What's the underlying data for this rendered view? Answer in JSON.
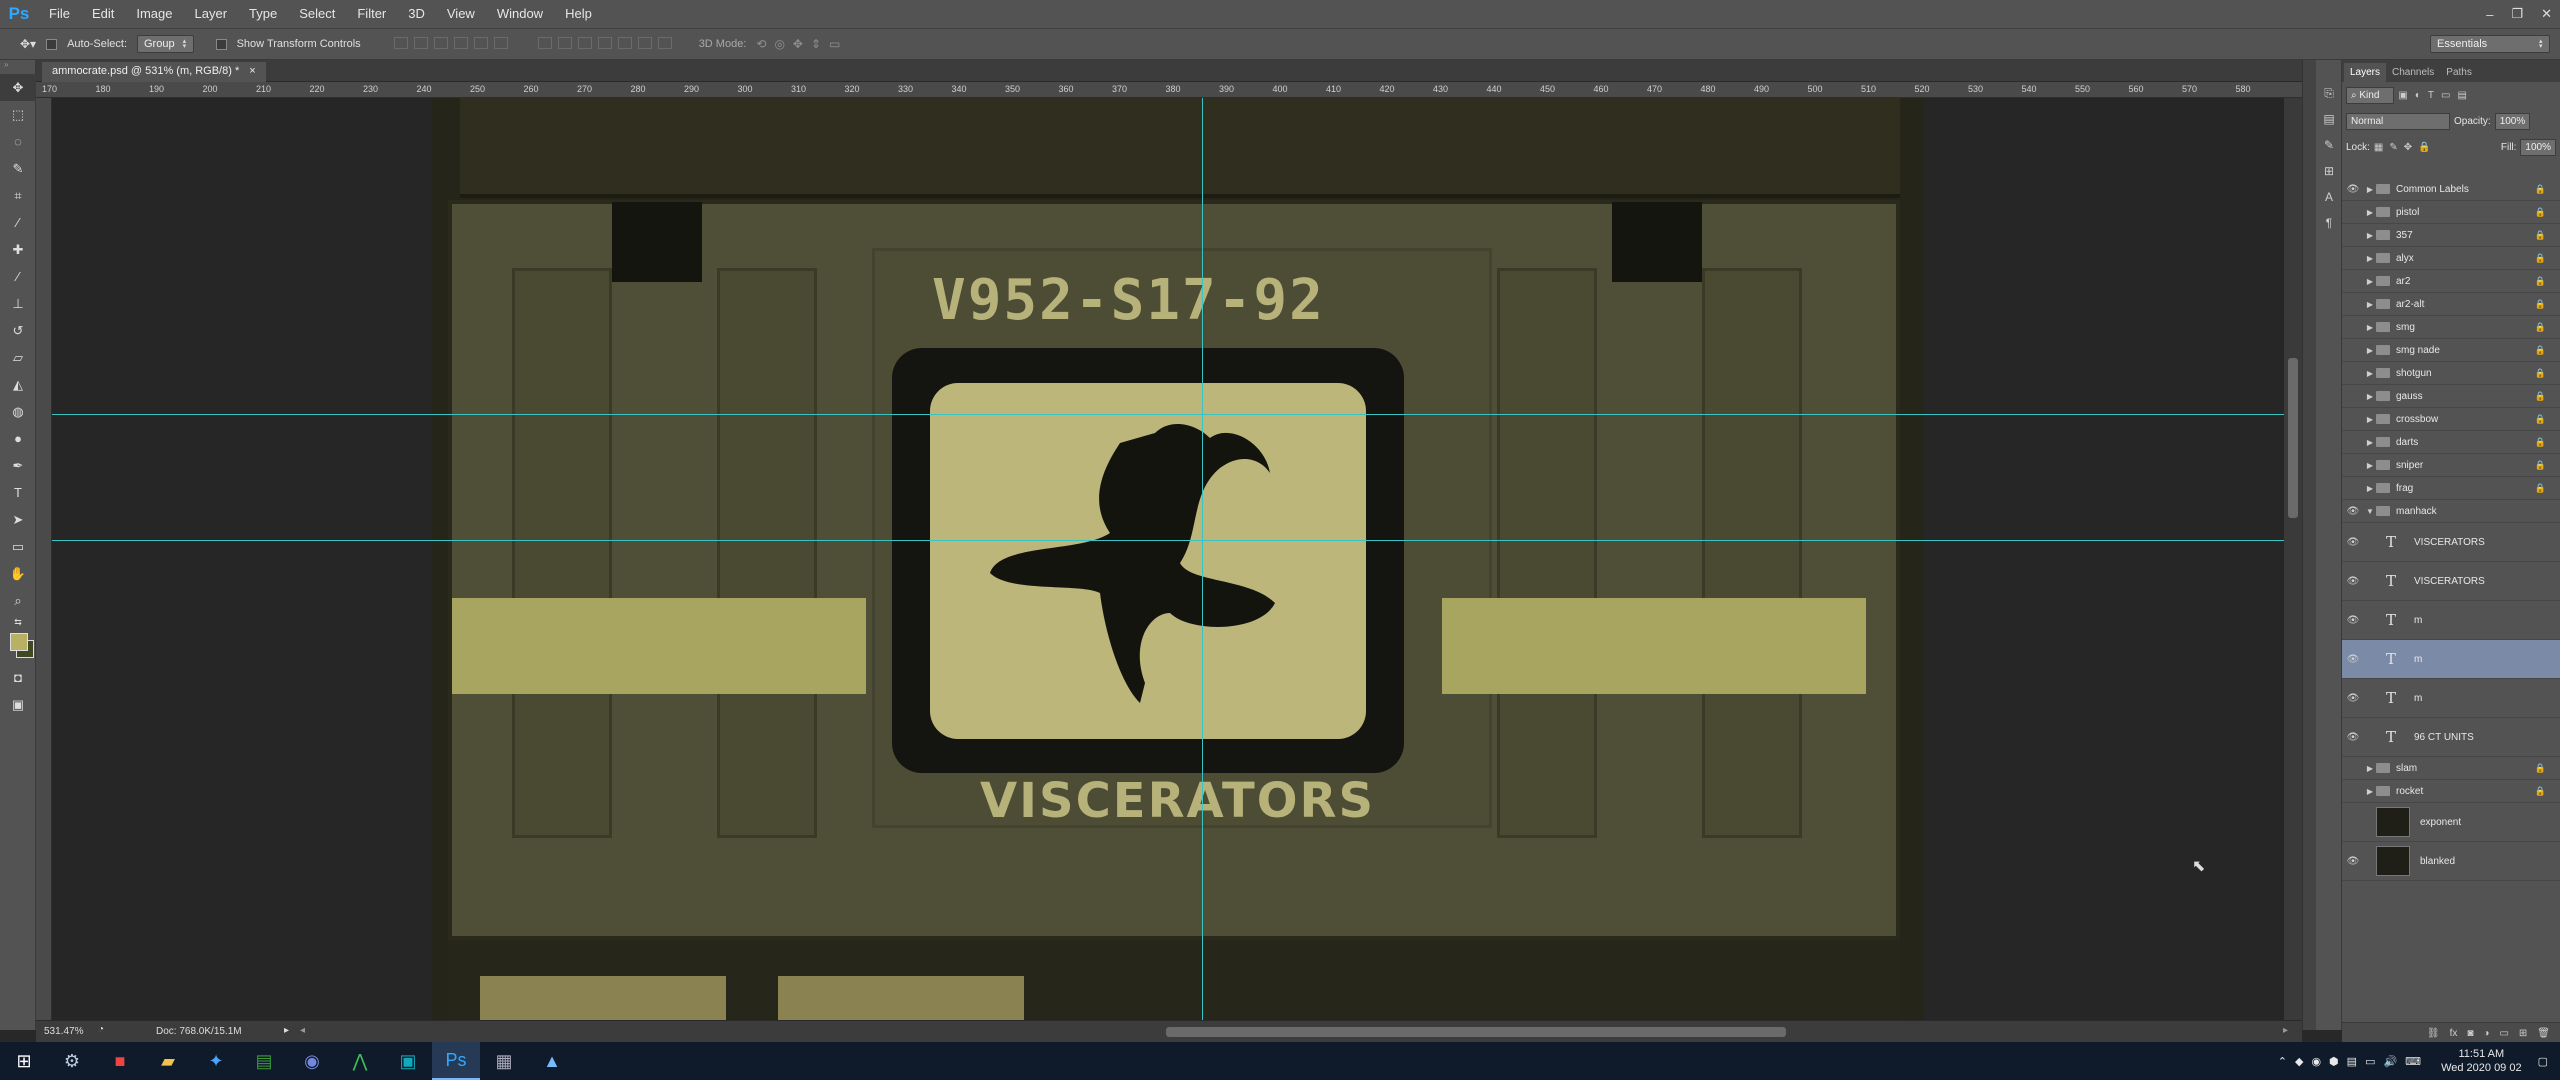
{
  "app": {
    "logo": "Ps",
    "menu": [
      "File",
      "Edit",
      "Image",
      "Layer",
      "Type",
      "Select",
      "Filter",
      "3D",
      "View",
      "Window",
      "Help"
    ],
    "window_controls": [
      "–",
      "❐",
      "✕"
    ]
  },
  "options_bar": {
    "auto_select_label": "Auto-Select:",
    "auto_select_value": "Group",
    "show_transform_label": "Show Transform Controls",
    "mode_3d_label": "3D Mode:",
    "workspace": "Essentials"
  },
  "document": {
    "tab_title": "ammocrate.psd @ 531% (m, RGB/8) *",
    "tab_close": "×",
    "ruler_ticks": [
      "170",
      "180",
      "190",
      "200",
      "210",
      "220",
      "230",
      "240",
      "250",
      "260",
      "270",
      "280",
      "290",
      "300",
      "310",
      "320",
      "330",
      "340",
      "350",
      "360",
      "370",
      "380",
      "390",
      "400",
      "410",
      "420",
      "430",
      "440",
      "450",
      "460",
      "470",
      "480",
      "490",
      "500",
      "510",
      "520",
      "530",
      "540",
      "550",
      "560",
      "570",
      "580"
    ],
    "artwork_code_text": "V952-S17-92",
    "artwork_name_text": "VISCERATORS"
  },
  "status": {
    "zoom": "531.47%",
    "doc_size": "Doc: 768.0K/15.1M"
  },
  "panel": {
    "tabs": [
      "Layers",
      "Channels",
      "Paths"
    ],
    "kind_label": "Kind",
    "blend_mode": "Normal",
    "opacity_label": "Opacity:",
    "opacity_value": "100%",
    "lock_label": "Lock:",
    "fill_label": "Fill:",
    "fill_value": "100%"
  },
  "layers": [
    {
      "name": "Common Labels",
      "type": "group",
      "visible": true,
      "locked": true
    },
    {
      "name": "pistol",
      "type": "group",
      "visible": false,
      "locked": true
    },
    {
      "name": "357",
      "type": "group",
      "visible": false,
      "locked": true
    },
    {
      "name": "alyx",
      "type": "group",
      "visible": false,
      "locked": true
    },
    {
      "name": "ar2",
      "type": "group",
      "visible": false,
      "locked": true
    },
    {
      "name": "ar2-alt",
      "type": "group",
      "visible": false,
      "locked": true
    },
    {
      "name": "smg",
      "type": "group",
      "visible": false,
      "locked": true
    },
    {
      "name": "smg nade",
      "type": "group",
      "visible": false,
      "locked": true
    },
    {
      "name": "shotgun",
      "type": "group",
      "visible": false,
      "locked": true
    },
    {
      "name": "gauss",
      "type": "group",
      "visible": false,
      "locked": true
    },
    {
      "name": "crossbow",
      "type": "group",
      "visible": false,
      "locked": true
    },
    {
      "name": "darts",
      "type": "group",
      "visible": false,
      "locked": true
    },
    {
      "name": "sniper",
      "type": "group",
      "visible": false,
      "locked": true
    },
    {
      "name": "frag",
      "type": "group",
      "visible": false,
      "locked": true
    },
    {
      "name": "manhack",
      "type": "group-open",
      "visible": true,
      "locked": false
    },
    {
      "name": "VISCERATORS",
      "type": "text",
      "visible": true,
      "locked": false
    },
    {
      "name": "VISCERATORS",
      "type": "text",
      "visible": true,
      "locked": false
    },
    {
      "name": "m",
      "type": "text",
      "visible": true,
      "locked": false
    },
    {
      "name": "m",
      "type": "text-selected",
      "visible": true,
      "locked": false
    },
    {
      "name": "m",
      "type": "text",
      "visible": true,
      "locked": false
    },
    {
      "name": "96 CT UNITS",
      "type": "text",
      "visible": true,
      "locked": false
    },
    {
      "name": "slam",
      "type": "group",
      "visible": false,
      "locked": true
    },
    {
      "name": "rocket",
      "type": "group",
      "visible": false,
      "locked": true
    },
    {
      "name": "exponent",
      "type": "image",
      "visible": false,
      "locked": false
    },
    {
      "name": "blanked",
      "type": "image",
      "visible": true,
      "locked": false
    }
  ],
  "taskbar": {
    "clock_time": "11:51 AM",
    "clock_date": "Wed 2020 09 02"
  }
}
